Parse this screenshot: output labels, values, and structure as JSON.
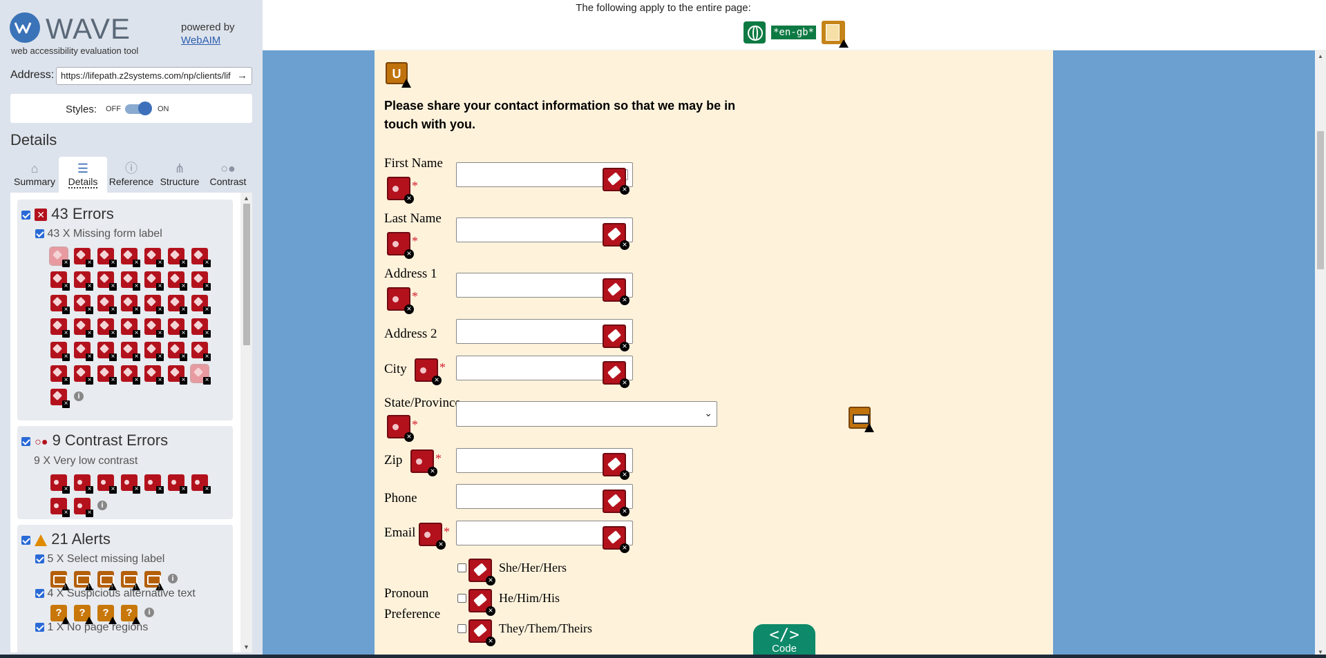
{
  "wave": {
    "logo_word": "WAVE",
    "tagline": "web accessibility evaluation tool",
    "powered_by": "powered by",
    "webaim_link": "WebAIM",
    "address_label": "Address:",
    "address_value": "https://lifepath.z2systems.com/np/clients/lif",
    "styles_label": "Styles:",
    "styles_off": "OFF",
    "styles_on": "ON",
    "styles_state": "on",
    "details_heading": "Details",
    "tabs": [
      {
        "label": "Summary",
        "icon": "home-icon"
      },
      {
        "label": "Details",
        "icon": "list-icon",
        "active": true
      },
      {
        "label": "Reference",
        "icon": "info-icon"
      },
      {
        "label": "Structure",
        "icon": "structure-icon"
      },
      {
        "label": "Contrast",
        "icon": "contrast-icon"
      }
    ],
    "groups": {
      "errors": {
        "title": "43 Errors",
        "item": "43 X Missing form label",
        "count": 43
      },
      "contrast": {
        "title": "9 Contrast Errors",
        "item": "9 X Very low contrast",
        "count": 9
      },
      "alerts": {
        "title": "21 Alerts",
        "items": [
          {
            "label": "5 X Select missing label",
            "count": 5
          },
          {
            "label": "4 X Suspicious alternative text",
            "count": 4
          },
          {
            "label": "1 X No page regions",
            "count": 1
          }
        ]
      }
    }
  },
  "page_header": {
    "applies_text": "The following apply to the entire page:",
    "lang_badge": "*en-gb*"
  },
  "form": {
    "intro": "Please share your contact information so that we may be in touch with you.",
    "fields": {
      "first_name": "First Name",
      "last_name": "Last Name",
      "address1": "Address 1",
      "address2": "Address 2",
      "city": "City",
      "state": "State/Province",
      "zip": "Zip",
      "phone": "Phone",
      "email": "Email",
      "pronoun": "Pronoun Preference"
    },
    "required_mark": "*",
    "pronoun_options": [
      "She/Her/Hers",
      "He/Him/His",
      "They/Them/Theirs"
    ]
  },
  "code_tab": {
    "glyph": "</>",
    "label": "Code"
  },
  "colors": {
    "wave_blue": "#3a73b8",
    "error_red": "#b3121d",
    "alert_orange": "#c0720c",
    "code_green": "#0e8a6a",
    "form_bg": "#fff2db",
    "page_bg": "#6ba0d0"
  }
}
